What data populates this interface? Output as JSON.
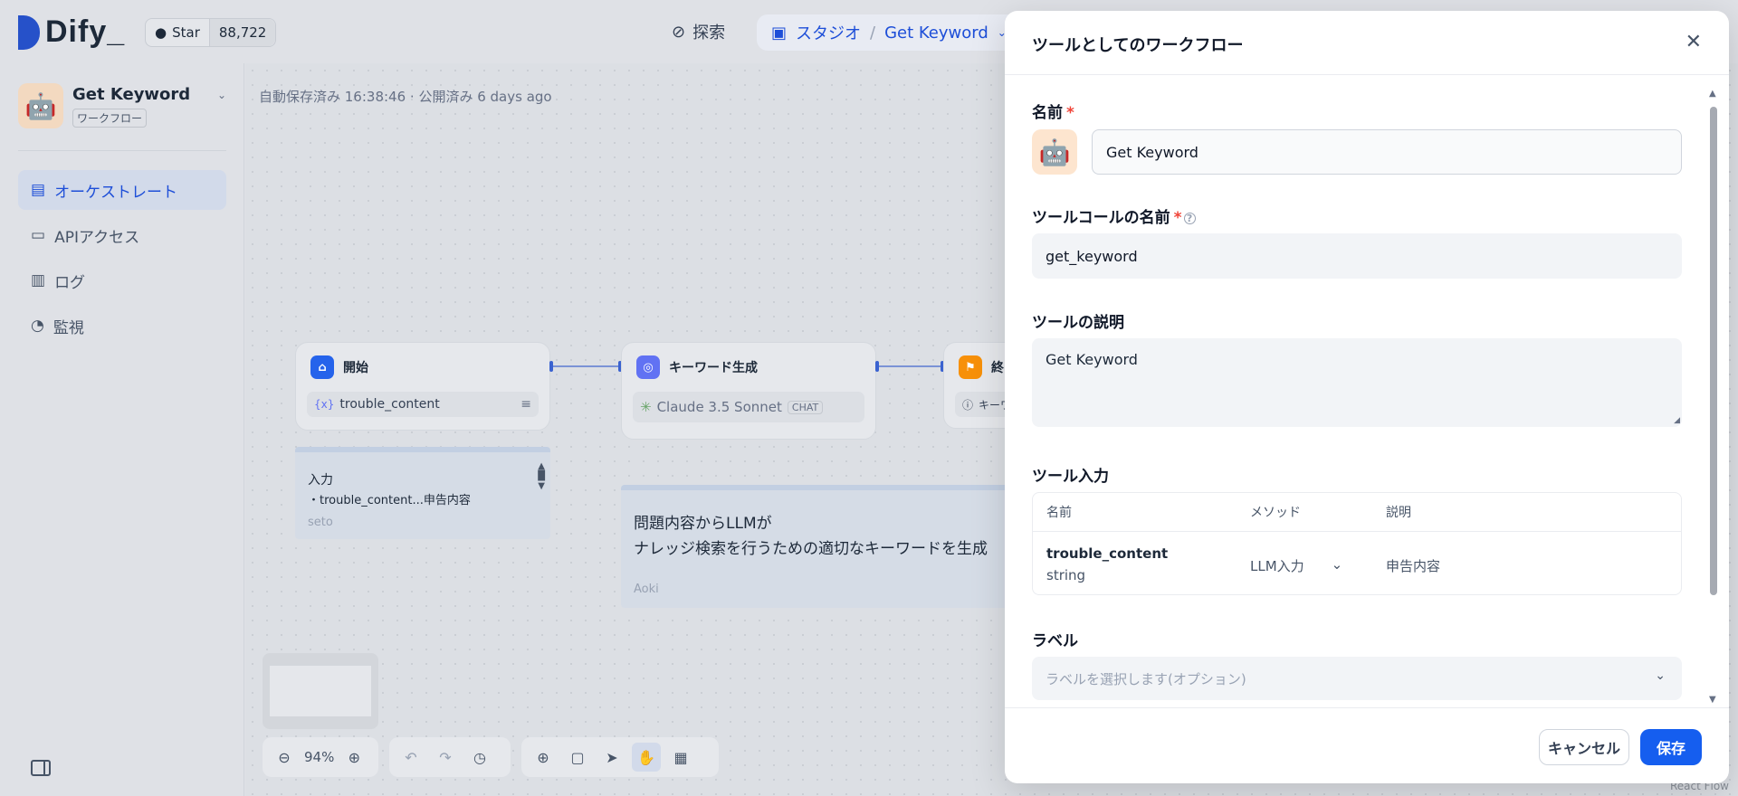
{
  "header": {
    "logo_text": "Dify_",
    "star_label": "Star",
    "star_count": "88,722",
    "explore": "探索",
    "studio": "スタジオ",
    "breadcrumb_sep": "/",
    "current_app": "Get Keyword"
  },
  "sidebar": {
    "app_name": "Get Keyword",
    "app_type": "ワークフロー",
    "items": [
      {
        "label": "オーケストレート",
        "icon": "layout-icon"
      },
      {
        "label": "APIアクセス",
        "icon": "terminal-icon"
      },
      {
        "label": "ログ",
        "icon": "file-list-icon"
      },
      {
        "label": "監視",
        "icon": "gauge-icon"
      }
    ]
  },
  "canvas": {
    "autosave": "自動保存済み 16:38:46 · 公開済み 6 days ago",
    "node_start": {
      "title": "開始",
      "var": "trouble_content"
    },
    "node_llm": {
      "title": "キーワード生成",
      "model": "Claude 3.5 Sonnet",
      "mode": "CHAT"
    },
    "node_end": {
      "title": "終",
      "var": "キーワ"
    },
    "note1": {
      "line1": "入力",
      "line2": "・trouble_content...申告内容",
      "author": "seto"
    },
    "note2": {
      "line1": "問題内容からLLMが",
      "line2": "ナレッジ検索を行うための適切なキーワードを生成",
      "author": "Aoki"
    },
    "zoom": "94%",
    "watermark": "React Flow"
  },
  "modal": {
    "title": "ツールとしてのワークフロー",
    "name_label": "名前",
    "name_value": "Get Keyword",
    "call_name_label": "ツールコールの名前",
    "call_name_value": "get_keyword",
    "desc_label": "ツールの説明",
    "desc_value": "Get Keyword",
    "input_label": "ツール入力",
    "table": {
      "headers": [
        "名前",
        "メソッド",
        "説明"
      ],
      "rows": [
        {
          "name": "trouble_content",
          "type": "string",
          "method": "LLM入力",
          "desc": "申告内容"
        }
      ]
    },
    "label_label": "ラベル",
    "label_placeholder": "ラベルを選択します(オプション)",
    "cancel": "キャンセル",
    "save": "保存"
  },
  "colors": {
    "accent": "#155eef",
    "studio": "#1d4ed8",
    "start_node": "#2563eb",
    "llm_node": "#6172f3",
    "end_node": "#f79009"
  }
}
